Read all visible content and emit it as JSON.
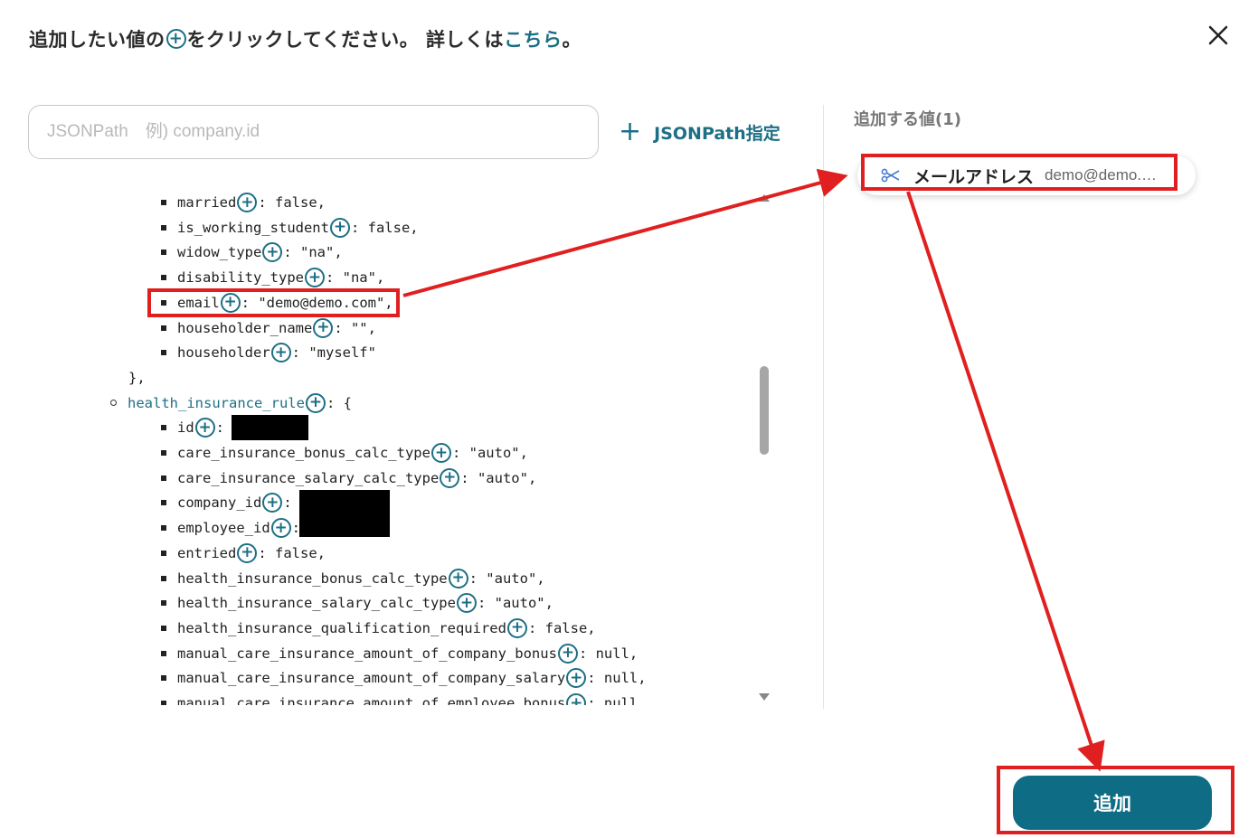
{
  "header": {
    "title_pre": "追加したい値の",
    "plus_glyph": "+",
    "title_post": "をクリックしてください。 詳しくは",
    "link_text": "こちら",
    "title_end": "。"
  },
  "search": {
    "placeholder": "JSONPath　例) company.id",
    "value": ""
  },
  "jsonpath_button": {
    "plus": "+",
    "label": "JSONPath指定"
  },
  "tree": [
    {
      "kind": "leaf",
      "key": "married",
      "value": ": false,"
    },
    {
      "kind": "leaf",
      "key": "is_working_student",
      "value": ": false,"
    },
    {
      "kind": "leaf",
      "key": "widow_type",
      "value": ": \"na\","
    },
    {
      "kind": "leaf",
      "key": "disability_type",
      "value": ": \"na\","
    },
    {
      "kind": "leaf",
      "key": "email",
      "value": ": \"demo@demo.com\","
    },
    {
      "kind": "leaf",
      "key": "householder_name",
      "value": ": \"\","
    },
    {
      "kind": "leaf",
      "key": "householder",
      "value": ": \"myself\""
    },
    {
      "kind": "close",
      "text": "},"
    },
    {
      "kind": "object",
      "key": "health_insurance_rule",
      "value": ": {"
    },
    {
      "kind": "leaf",
      "key": "id",
      "value": ":"
    },
    {
      "kind": "leaf",
      "key": "care_insurance_bonus_calc_type",
      "value": ": \"auto\","
    },
    {
      "kind": "leaf",
      "key": "care_insurance_salary_calc_type",
      "value": ": \"auto\","
    },
    {
      "kind": "leaf",
      "key": "company_id",
      "value": ":"
    },
    {
      "kind": "leaf",
      "key": "employee_id",
      "value": ":"
    },
    {
      "kind": "leaf",
      "key": "entried",
      "value": ": false,"
    },
    {
      "kind": "leaf",
      "key": "health_insurance_bonus_calc_type",
      "value": ": \"auto\","
    },
    {
      "kind": "leaf",
      "key": "health_insurance_salary_calc_type",
      "value": ": \"auto\","
    },
    {
      "kind": "leaf",
      "key": "health_insurance_qualification_required",
      "value": ": false,"
    },
    {
      "kind": "leaf",
      "key": "manual_care_insurance_amount_of_company_bonus",
      "value": ": null,"
    },
    {
      "kind": "leaf",
      "key": "manual_care_insurance_amount_of_company_salary",
      "value": ": null,"
    },
    {
      "kind": "leaf",
      "key": "manual_care_insurance_amount_of_employee_bonus",
      "value": ": null,"
    }
  ],
  "added": {
    "title": "追加する値(1)",
    "items": [
      {
        "icon": "scissors-icon",
        "label": "メールアドレス",
        "value": "demo@demo.…"
      }
    ]
  },
  "add_button": {
    "label": "追加"
  },
  "colors": {
    "accent": "#1d6f86",
    "button": "#0e6d84",
    "annotation": "#e02020"
  }
}
